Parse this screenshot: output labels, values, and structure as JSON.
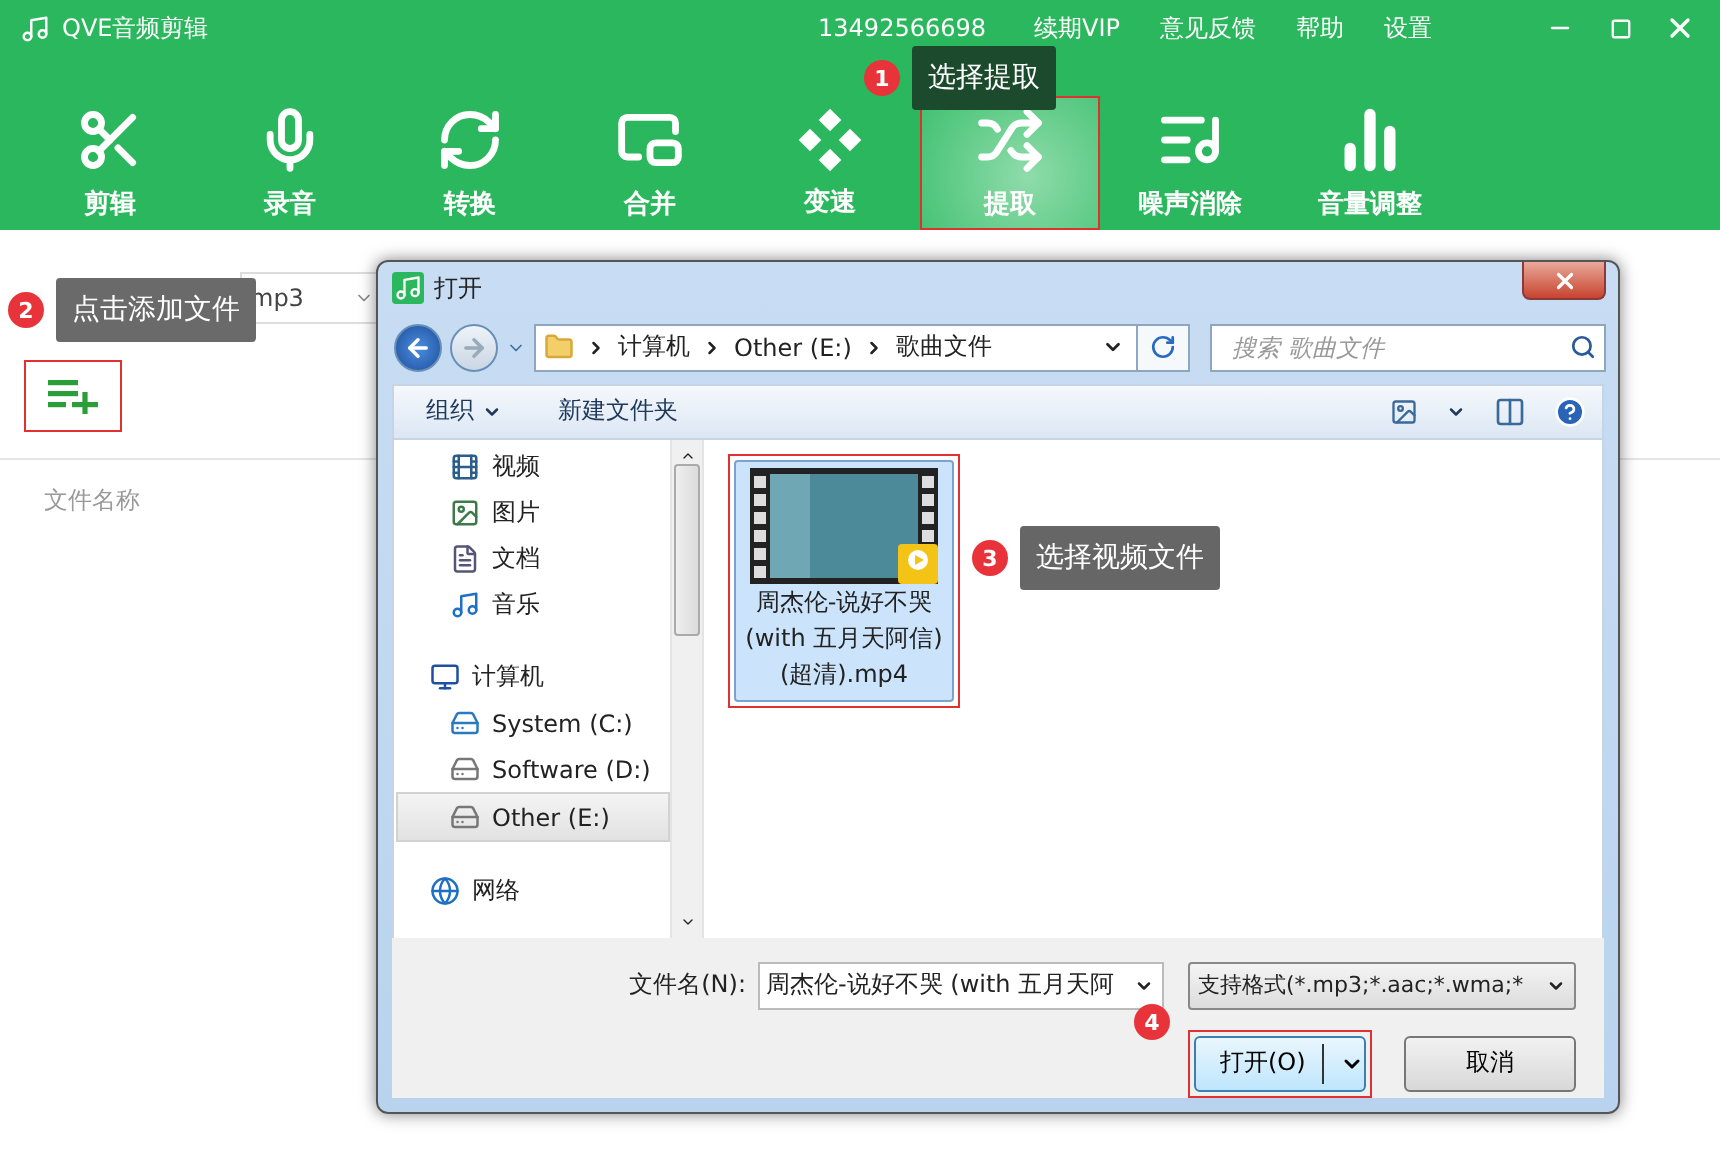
{
  "app": {
    "title": "QVE音频剪辑",
    "phone": "13492566698",
    "menu": [
      "续期VIP",
      "意见反馈",
      "帮助",
      "设置"
    ]
  },
  "toolbar": [
    {
      "label": "剪辑",
      "kind": "scissors",
      "selected": false,
      "highlighted": false
    },
    {
      "label": "录音",
      "kind": "mic",
      "selected": false,
      "highlighted": false
    },
    {
      "label": "转换",
      "kind": "convert",
      "selected": false,
      "highlighted": false
    },
    {
      "label": "合并",
      "kind": "merge",
      "selected": false,
      "highlighted": false
    },
    {
      "label": "变速",
      "kind": "speed",
      "selected": false,
      "highlighted": false
    },
    {
      "label": "提取",
      "kind": "extract",
      "selected": true,
      "highlighted": true
    },
    {
      "label": "噪声消除",
      "kind": "noise",
      "selected": false,
      "highlighted": false
    },
    {
      "label": "音量调整",
      "kind": "volume",
      "selected": false,
      "highlighted": false
    }
  ],
  "format_select": {
    "value": "mp3"
  },
  "add_button": {
    "highlighted": true
  },
  "file_list": {
    "column": "文件名称"
  },
  "dialog": {
    "title": "打开",
    "breadcrumb": [
      "计算机",
      "Other (E:)",
      "歌曲文件"
    ],
    "search": {
      "placeholder": "搜索 歌曲文件"
    },
    "commands": [
      {
        "label": "组织",
        "kind": "menu"
      },
      {
        "label": "新建文件夹",
        "kind": "plain"
      }
    ],
    "nav": [
      {
        "children": [
          {
            "label": "视频",
            "kind": "video",
            "selected": false
          },
          {
            "label": "图片",
            "kind": "picture",
            "selected": false
          },
          {
            "label": "文档",
            "kind": "document",
            "selected": false
          },
          {
            "label": "音乐",
            "kind": "music",
            "selected": false
          }
        ]
      },
      {
        "label": "计算机",
        "kind": "computer",
        "children": [
          {
            "label": "System (C:)",
            "kind": "system",
            "selected": false
          },
          {
            "label": "Software (D:)",
            "kind": "drive",
            "selected": false
          },
          {
            "label": "Other (E:)",
            "kind": "drive",
            "selected": true
          }
        ]
      },
      {
        "label": "网络",
        "kind": "network"
      }
    ],
    "files": [
      {
        "name": "周杰伦-说好不哭 (with 五月天阿信)(超清).mp4",
        "selected": true,
        "highlighted": true
      }
    ],
    "filename_label": "文件名(N):",
    "filename_value": "周杰伦-说好不哭 (with 五月天阿",
    "filetype": "支持格式(*.mp3;*.aac;*.wma;*",
    "open_button": {
      "label": "打开(O)",
      "highlighted": true
    },
    "cancel_button": {
      "label": "取消"
    }
  },
  "annotations": [
    {
      "number": "1",
      "text": "选择提取"
    },
    {
      "number": "2",
      "text": "点击添加文件"
    },
    {
      "number": "3",
      "text": "选择视频文件"
    },
    {
      "number": "4"
    }
  ]
}
